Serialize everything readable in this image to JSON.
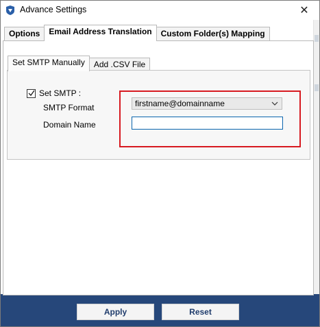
{
  "window": {
    "title": "Advance Settings",
    "close_glyph": "✕"
  },
  "tabs": [
    {
      "label": "Options",
      "active": false
    },
    {
      "label": "Email Address Translation",
      "active": true
    },
    {
      "label": "Custom Folder(s) Mapping",
      "active": false
    }
  ],
  "subtabs": [
    {
      "label": "Set SMTP Manually",
      "active": true
    },
    {
      "label": "Add .CSV File",
      "active": false
    }
  ],
  "smtp": {
    "checkbox_label": "Set SMTP :",
    "checked": true,
    "format_label": "SMTP Format",
    "format_value": "firstname@domainname",
    "domain_label": "Domain Name",
    "domain_value": ""
  },
  "buttons": {
    "apply": "Apply",
    "reset": "Reset"
  },
  "colors": {
    "footer": "#26477a",
    "highlight": "#d71920",
    "input_border": "#0a64ad"
  },
  "icons": {
    "app": "app-logo-icon",
    "close": "close-icon",
    "dropdown": "chevron-down-icon",
    "check": "checkmark-icon"
  }
}
